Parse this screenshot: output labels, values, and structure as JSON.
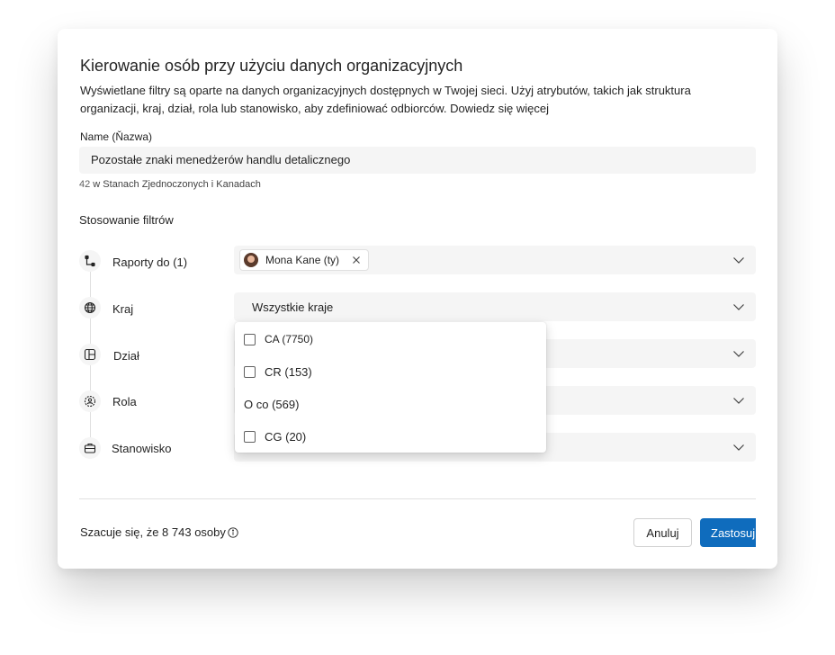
{
  "dialog": {
    "title": "Kierowanie osób przy użyciu danych organizacyjnych",
    "description": "Wyświetlane filtry są oparte na danych organizacyjnych dostępnych w Twojej sieci. Użyj atrybutów, takich jak struktura organizacji, kraj, dział, rola lub stanowisko, aby zdefiniować odbiorców. Dowiedz się więcej"
  },
  "name_field": {
    "label": "Name (Ňazwa)",
    "value": "Pozostałe znaki menedżerów handlu detalicznego",
    "helper_count": "42",
    "helper_text": " w Stanach Zjednoczonych i Kanadach"
  },
  "filters": {
    "section_title": "Stosowanie filtrów",
    "reports_to": {
      "label": "Raporty do (1)",
      "chip_label": "Mona Kane (ty)",
      "icon": "org-chart-icon"
    },
    "country": {
      "label": "Kraj",
      "value": "Wszystkie kraje",
      "icon": "globe-icon"
    },
    "department": {
      "label": "Dział",
      "icon": "department-icon"
    },
    "role": {
      "label": "Rola",
      "icon": "person-badge-icon"
    },
    "position": {
      "label": "Stanowisko",
      "icon": "briefcase-icon"
    }
  },
  "country_dropdown": {
    "options": [
      {
        "label": "CA (7750)",
        "checkbox": true
      },
      {
        "label": "CR (153)",
        "checkbox": true
      },
      {
        "label": "O co (569)",
        "checkbox": false
      },
      {
        "label": "CG (20)",
        "checkbox": true
      }
    ]
  },
  "footer": {
    "estimate": "Szacuje się, że 8 743 osoby",
    "cancel_label": "Anuluj",
    "apply_label": "Zastosuj"
  },
  "colors": {
    "primary": "#0f6cbd",
    "field_background": "#f5f5f5"
  }
}
